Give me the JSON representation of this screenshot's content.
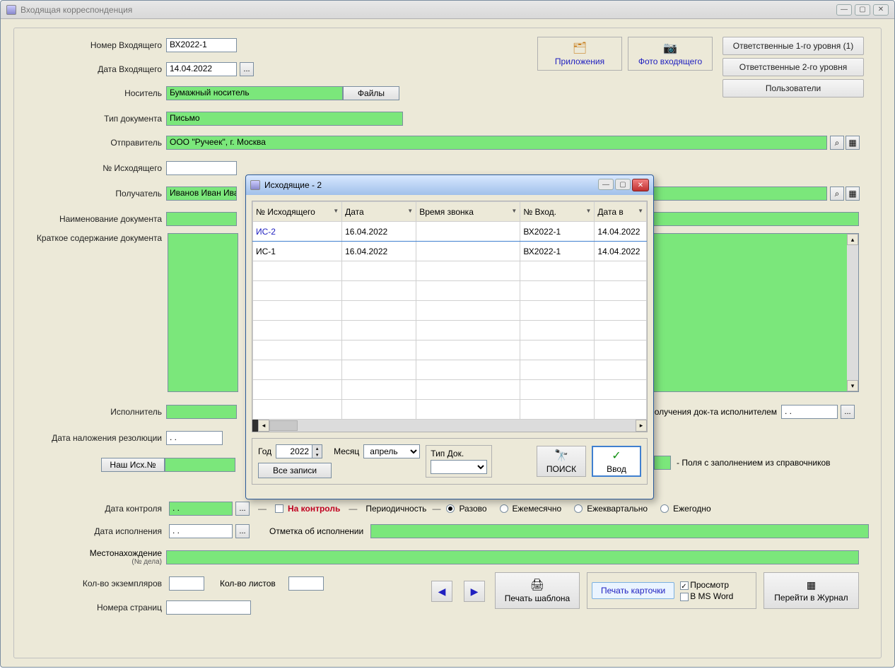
{
  "window": {
    "title": "Входящая корреспонденция"
  },
  "toolbar": {
    "attachments": "Приложения",
    "photo": "Фото входящего",
    "resp1": "Ответственные 1-го уровня (1)",
    "resp2": "Ответственные 2-го уровня",
    "users": "Пользователи"
  },
  "labels": {
    "number_in": "Номер Входящего",
    "date_in": "Дата Входящего",
    "medium": "Носитель",
    "files": "Файлы",
    "doctype": "Тип документа",
    "sender": "Отправитель",
    "number_out": "№ Исходящего",
    "recipient": "Получатель",
    "docname": "Наименование документа",
    "summary": "Краткое содержание\nдокумента",
    "executor": "Исполнитель",
    "recv_date": "олучения док-та исполнителем",
    "resolution_date": "Дата наложения резолюции",
    "our_out": "Наш Исх.№",
    "legend": "- Поля с заполнением из справочников",
    "control_date": "Дата контроля",
    "on_control": "На контроль",
    "periodicity": "Периодичность",
    "period_once": "Разово",
    "period_month": "Ежемесячно",
    "period_quarter": "Ежеквартально",
    "period_year": "Ежегодно",
    "exec_date": "Дата исполнения",
    "exec_mark": "Отметка об исполнении",
    "location": "Местонахождение",
    "location_sub": "(№ дела)",
    "copies": "Кол-во экземпляров",
    "sheets": "Кол-во листов",
    "pages": "Номера страниц"
  },
  "values": {
    "number_in": "ВХ2022-1",
    "date_in": "14.04.2022",
    "medium": "Бумажный носитель",
    "doctype": "Письмо",
    "sender": "ООО \"Ручеек\", г. Москва",
    "number_out": "",
    "recipient": "Иванов Иван Ива",
    "docname": "",
    "summary": "",
    "executor": "",
    "recv_date": ".   .",
    "resolution_date": ".   .",
    "our_out": "",
    "control_date": ".   .",
    "exec_date": ".   .",
    "exec_mark": "",
    "location": "",
    "copies": "",
    "sheets": "",
    "pages": ""
  },
  "buttons": {
    "print_template": "Печать шаблона",
    "print_card": "Печать карточки",
    "preview": "Просмотр",
    "in_word": "В MS Word",
    "to_journal": "Перейти в Журнал"
  },
  "modal": {
    "title": "Исходящие - 2",
    "columns": [
      "№ Исходящего",
      "Дата",
      "Время звонка",
      "№ Вход.",
      "Дата в"
    ],
    "rows": [
      {
        "out": "ИС-2",
        "date": "16.04.2022",
        "call": "",
        "in": "ВХ2022-1",
        "date_in": "14.04.2022"
      },
      {
        "out": "ИС-1",
        "date": "16.04.2022",
        "call": "",
        "in": "ВХ2022-1",
        "date_in": "14.04.2022"
      }
    ],
    "filter": {
      "year_label": "Год",
      "year": "2022",
      "month_label": "Месяц",
      "month": "апрель",
      "doctype_label": "Тип Док.",
      "all_records": "Все записи",
      "search": "ПОИСК",
      "enter": "Ввод"
    }
  }
}
